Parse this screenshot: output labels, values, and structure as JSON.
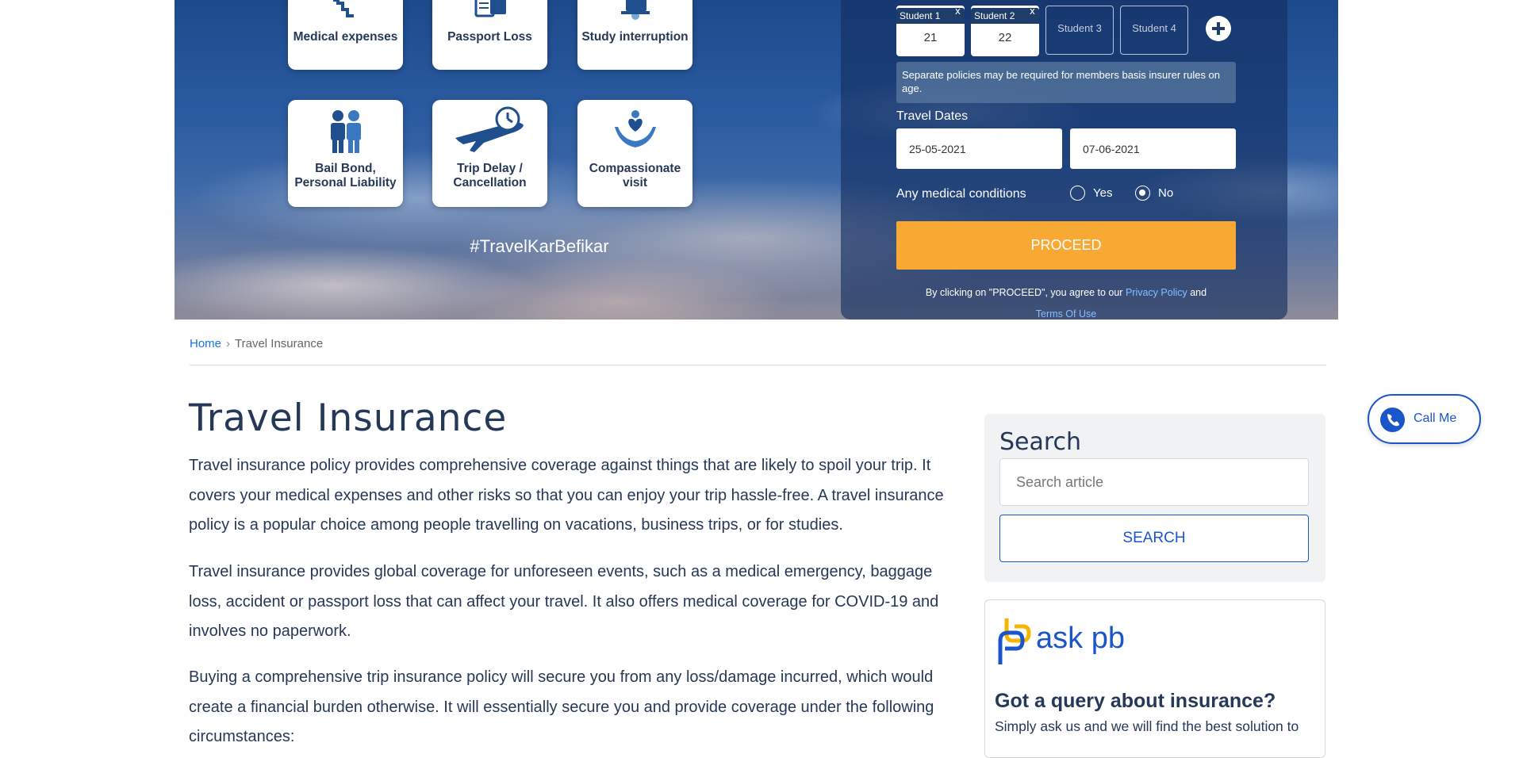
{
  "hero": {
    "tiles": [
      {
        "label": "Medical expenses",
        "icon": "medical-expenses-icon"
      },
      {
        "label": "Passport Loss",
        "icon": "passport-loss-icon"
      },
      {
        "label": "Study interruption",
        "icon": "study-interruption-icon"
      },
      {
        "label": "Bail Bond, Personal Liability",
        "icon": "bail-bond-icon"
      },
      {
        "label": "Trip Delay / Cancellation",
        "icon": "trip-delay-icon"
      },
      {
        "label": "Compassionate visit",
        "icon": "compassionate-visit-icon"
      }
    ],
    "hashtag": "#TravelKarBefikar"
  },
  "form": {
    "students": [
      {
        "label": "Student 1",
        "age": "21",
        "remove": "x"
      },
      {
        "label": "Student 2",
        "age": "22",
        "remove": "x"
      }
    ],
    "empty_students": [
      "Student 3",
      "Student 4"
    ],
    "note": "Separate policies may be required for members basis insurer rules on age.",
    "travel_dates_label": "Travel Dates",
    "start_date": "25-05-2021",
    "end_date": "07-06-2021",
    "medical_label": "Any medical conditions",
    "yes_label": "Yes",
    "no_label": "No",
    "medical_selected": "No",
    "proceed_label": "PROCEED",
    "agree_text": "By clicking on \"PROCEED\", you agree to our",
    "privacy_link": "Privacy Policy",
    "and_text": "and",
    "terms_link": "Terms Of Use"
  },
  "breadcrumb": {
    "home": "Home",
    "separator": "›",
    "current": "Travel Insurance"
  },
  "article": {
    "title": "Travel Insurance",
    "paragraphs": [
      "Travel insurance policy provides comprehensive coverage against things that are likely to spoil your trip. It covers your medical expenses and other risks so that you can enjoy your trip hassle-free. A travel insurance policy is a popular choice among people travelling on vacations, business trips, or for studies.",
      "Travel insurance provides global coverage for unforeseen events, such as a medical emergency, baggage loss, accident or passport loss that can affect your travel. It also offers medical coverage for COVID-19 and involves no paperwork.",
      "Buying a comprehensive trip insurance policy will secure you from any loss/damage incurred, which would create a financial burden otherwise. It will essentially secure you and provide coverage under the following circumstances:"
    ]
  },
  "sidebar": {
    "search_title": "Search",
    "search_placeholder": "Search article",
    "search_button": "SEARCH",
    "askpb_logo": "ask pb",
    "askpb_heading": "Got a query about insurance?",
    "askpb_text": "Simply ask us and we will find the best solution to"
  },
  "callme": {
    "label": "Call Me"
  },
  "colors": {
    "brand_blue": "#1a56c9",
    "navy": "#253858",
    "orange": "#f8a933"
  }
}
